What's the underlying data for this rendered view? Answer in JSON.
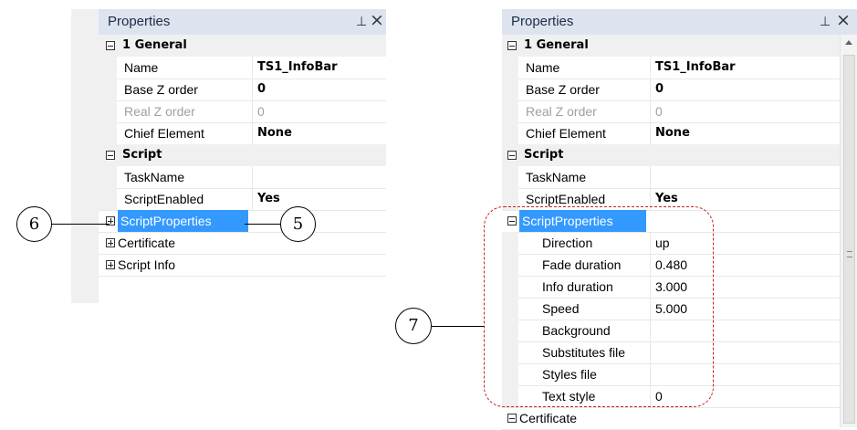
{
  "panel_title": "Properties",
  "pin_glyph": "⊥",
  "close_glyph": "×",
  "left_panel": {
    "rows": [
      {
        "type": "cat",
        "label": "1 General"
      },
      {
        "type": "prop",
        "label": "Name",
        "value": "TS1_InfoBar",
        "bold": true
      },
      {
        "type": "prop",
        "label": "Base Z order",
        "value": "0",
        "bold": true
      },
      {
        "type": "prop",
        "label": "Real Z order",
        "value": "0",
        "grey": true
      },
      {
        "type": "prop",
        "label": "Chief Element",
        "value": "None",
        "bold": true
      },
      {
        "type": "cat",
        "label": "Script"
      },
      {
        "type": "prop",
        "label": "TaskName",
        "value": ""
      },
      {
        "type": "prop",
        "label": "ScriptEnabled",
        "value": "Yes",
        "bold": true
      },
      {
        "type": "group",
        "label": "ScriptProperties",
        "selected": true
      },
      {
        "type": "group",
        "label": "Certificate"
      },
      {
        "type": "group",
        "label": "Script Info"
      }
    ]
  },
  "right_panel": {
    "rows": [
      {
        "type": "cat",
        "label": "1 General"
      },
      {
        "type": "prop",
        "label": "Name",
        "value": "TS1_InfoBar",
        "bold": true
      },
      {
        "type": "prop",
        "label": "Base Z order",
        "value": "0",
        "bold": true
      },
      {
        "type": "prop",
        "label": "Real Z order",
        "value": "0",
        "grey": true
      },
      {
        "type": "prop",
        "label": "Chief Element",
        "value": "None",
        "bold": true
      },
      {
        "type": "cat",
        "label": "Script"
      },
      {
        "type": "prop",
        "label": "TaskName",
        "value": ""
      },
      {
        "type": "prop",
        "label": "ScriptEnabled",
        "value": "Yes",
        "bold": true
      },
      {
        "type": "group-open",
        "label": "ScriptProperties",
        "selected": true
      },
      {
        "type": "sub",
        "label": "Direction",
        "value": "up"
      },
      {
        "type": "sub",
        "label": "Fade duration",
        "value": "0.480"
      },
      {
        "type": "sub",
        "label": "Info duration",
        "value": "3.000"
      },
      {
        "type": "sub",
        "label": "Speed",
        "value": "5.000"
      },
      {
        "type": "sub",
        "label": "Background",
        "value": ""
      },
      {
        "type": "sub",
        "label": "Substitutes file",
        "value": ""
      },
      {
        "type": "sub",
        "label": "Styles file",
        "value": ""
      },
      {
        "type": "sub",
        "label": "Text style",
        "value": "0"
      },
      {
        "type": "group-open",
        "label": "Certificate"
      }
    ]
  },
  "callouts": {
    "c6": "6",
    "c5": "5",
    "c7": "7"
  },
  "colors": {
    "selection": "#3399ff",
    "titlebar": "#dde4f0",
    "dashed_frame": "#cc1f1f"
  }
}
